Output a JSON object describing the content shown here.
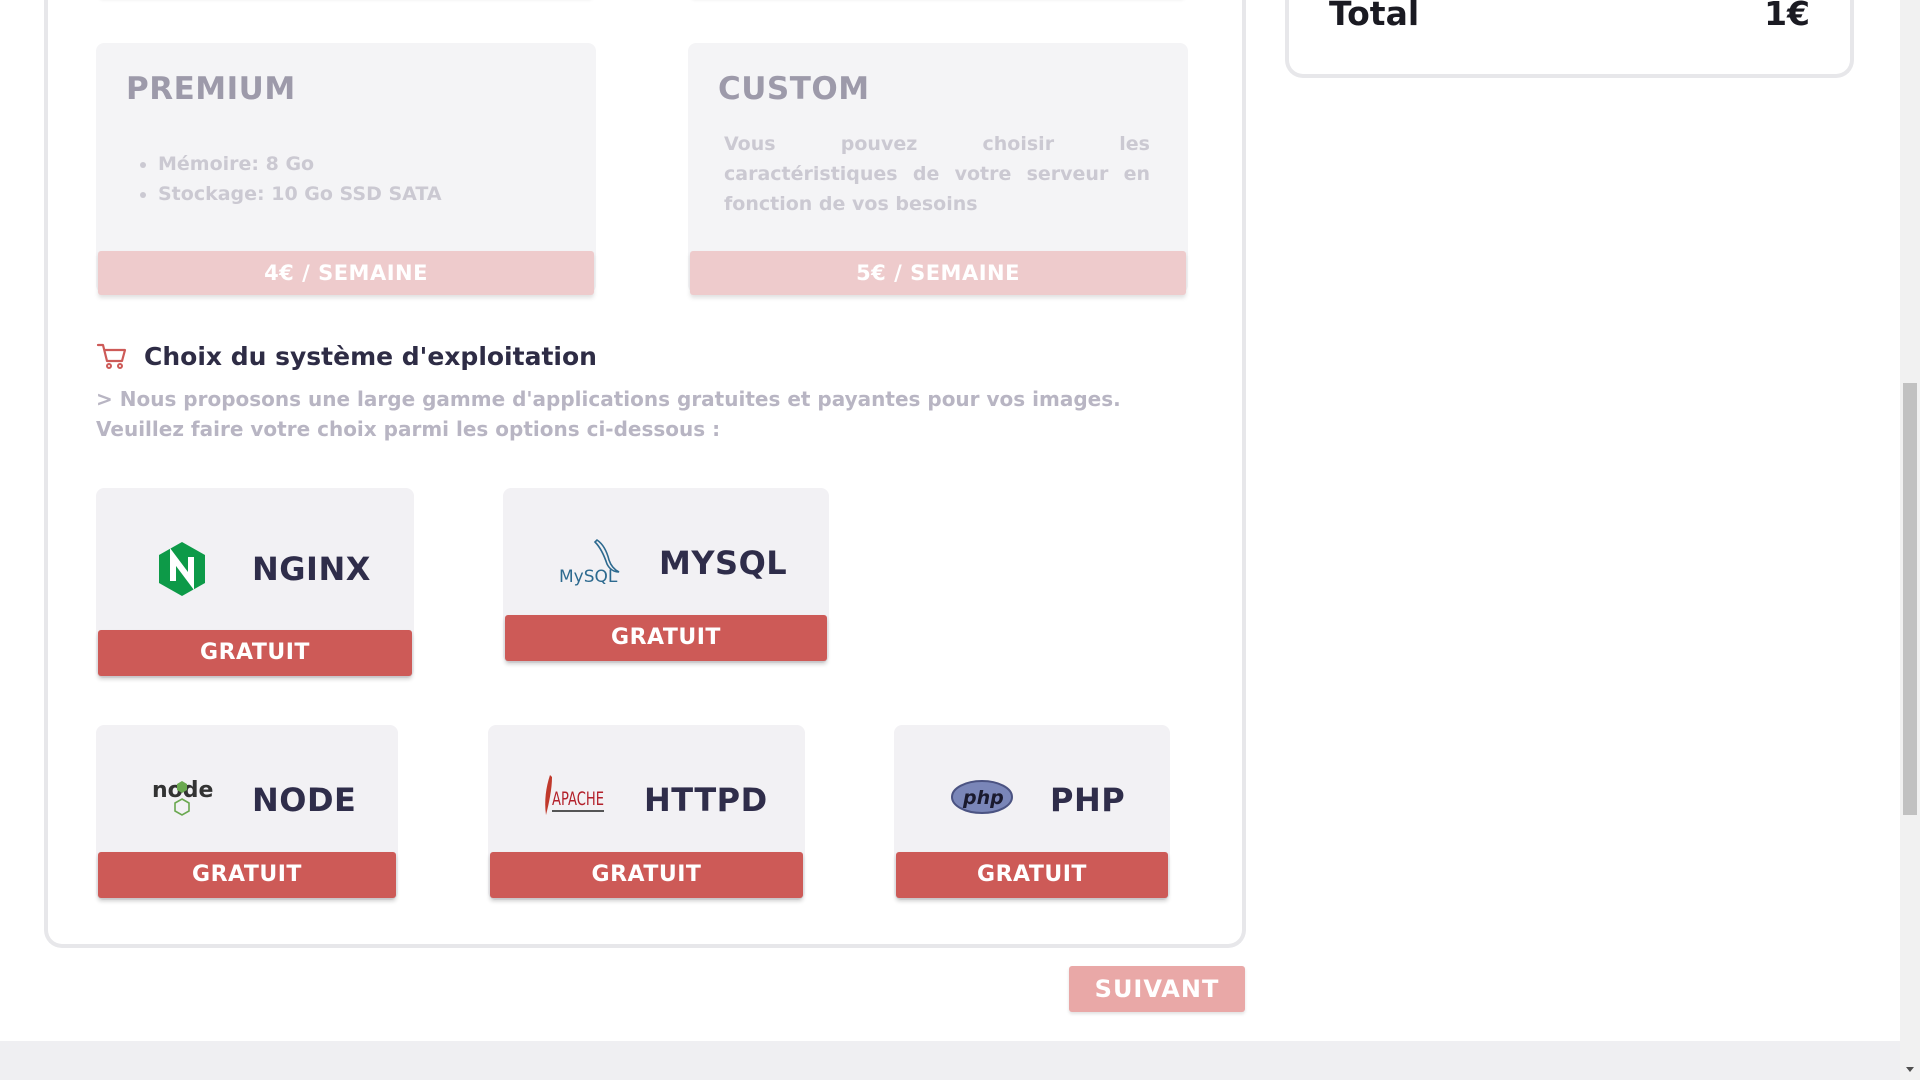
{
  "plans": [
    {
      "title": "PREMIUM",
      "features": [
        "Mémoire: 8 Go",
        "Stockage: 10 Go SSD SATA"
      ],
      "price": "4€ / SEMAINE"
    },
    {
      "title": "CUSTOM",
      "description": "Vous pouvez choisir les caractéristiques de votre serveur en fonction de vos besoins",
      "price": "5€ / SEMAINE"
    }
  ],
  "os_section": {
    "icon": "cart-icon",
    "title": "Choix du système d'exploitation",
    "description": "> Nous proposons une large gamme d'applications gratuites et payantes pour vos images. Veuillez faire votre choix parmi les options ci-dessous :"
  },
  "os_options": [
    {
      "name": "NGINX",
      "logo": "nginx-logo",
      "price": "GRATUIT"
    },
    {
      "name": "MYSQL",
      "logo": "mysql-logo",
      "logo_text": "MySQL",
      "price": "GRATUIT"
    },
    {
      "name": "NODE",
      "logo": "node-logo",
      "logo_text": "node",
      "price": "GRATUIT"
    },
    {
      "name": "HTTPD",
      "logo": "apache-logo",
      "logo_text": "APACHE",
      "price": "GRATUIT"
    },
    {
      "name": "PHP",
      "logo": "php-logo",
      "logo_text": "php",
      "price": "GRATUIT"
    }
  ],
  "next_button": "SUIVANT",
  "summary": {
    "total_label": "Total",
    "total_value": "1€"
  },
  "colors": {
    "accent": "#cd5a57",
    "accent_light": "#eecbcc",
    "card_bg": "#f4f4f6",
    "heading": "#2f2d4a"
  }
}
